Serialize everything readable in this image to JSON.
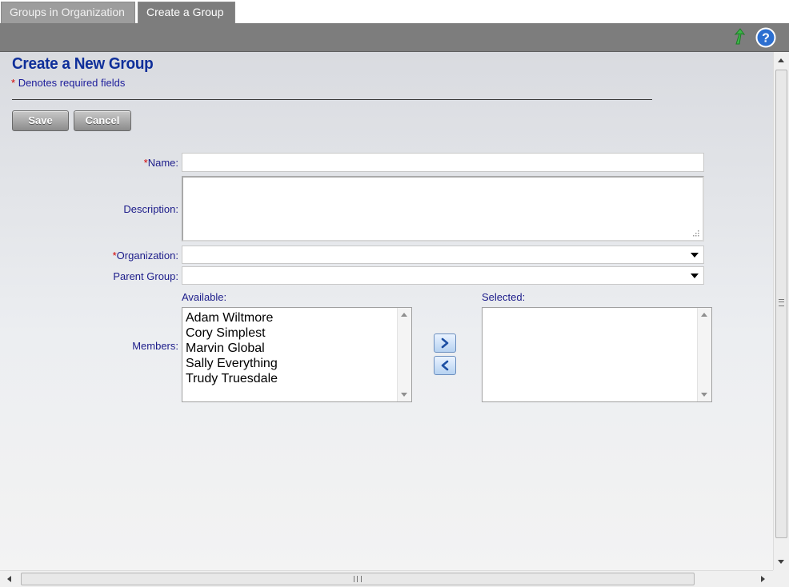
{
  "tabs": [
    {
      "label": "Groups in Organization",
      "active": false
    },
    {
      "label": "Create a Group",
      "active": true
    }
  ],
  "toolbar": {
    "icons": [
      "back-arrow-icon",
      "help-icon"
    ],
    "help_glyph": "?"
  },
  "form": {
    "title": "Create a New Group",
    "required_star": "*",
    "required_note": "Denotes required fields",
    "save_label": "Save",
    "cancel_label": "Cancel",
    "name_label": "Name:",
    "name_value": "",
    "description_label": "Description:",
    "description_value": "",
    "organization_label": "Organization:",
    "organization_value": "",
    "parent_group_label": "Parent Group:",
    "parent_group_value": "",
    "members_label": "Members:",
    "available_label": "Available:",
    "selected_label": "Selected:",
    "available_members": [
      "Adam Wiltmore",
      "Cory Simplest",
      "Marvin Global",
      "Sally Everything",
      "Trudy Truesdale"
    ],
    "selected_members": []
  },
  "colors": {
    "title": "#0f2f9a",
    "required": "#d10000",
    "label": "#1c1c8a",
    "toolbar": "#7d7d7d"
  }
}
